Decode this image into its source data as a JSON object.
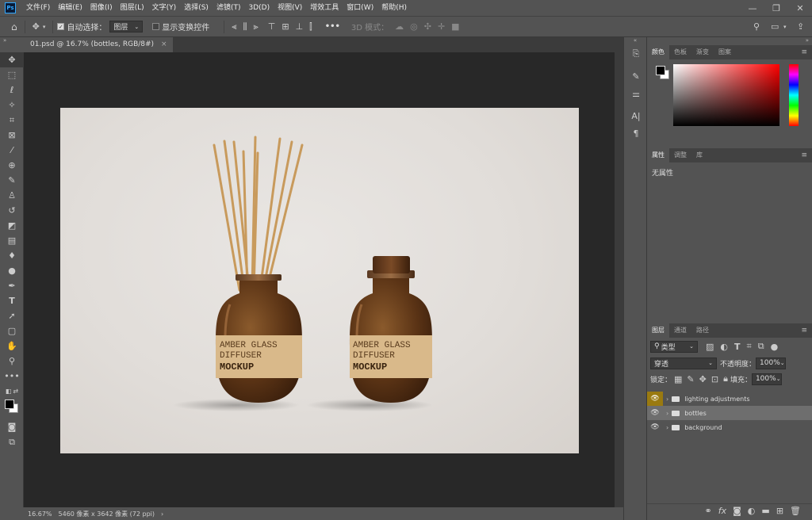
{
  "menubar": {
    "logo": "Ps",
    "items": [
      "文件(F)",
      "编辑(E)",
      "图像(I)",
      "图层(L)",
      "文字(Y)",
      "选择(S)",
      "滤镜(T)",
      "3D(D)",
      "视图(V)",
      "增效工具",
      "窗口(W)",
      "帮助(H)"
    ]
  },
  "window": {
    "minimize": "—",
    "restore": "❐",
    "close": "✕"
  },
  "options": {
    "auto_select_label": "自动选择：",
    "auto_select_target": "图层",
    "show_transform_label": "显示变换控件",
    "more": "•••",
    "mode_3d_label": "3D 模式："
  },
  "document_tab": {
    "title": "01.psd @ 16.7% (bottles, RGB/8#)",
    "close": "×"
  },
  "status": {
    "zoom": "16.67%",
    "dimensions": "5460 像素 x 3642 像素 (72 ppi)",
    "arrow": "›"
  },
  "mockup": {
    "left_label": [
      "AMBER GLASS",
      "DIFFUSER",
      "MOCKUP"
    ],
    "right_label": [
      "AMBER GLASS",
      "DIFFUSER",
      "MOCKUP"
    ]
  },
  "color_panel": {
    "tabs": [
      "颜色",
      "色板",
      "渐变",
      "图案"
    ],
    "fg": "#000000",
    "bg": "#ffffff",
    "hue_color": "#ff0000"
  },
  "properties_panel": {
    "tabs": [
      "属性",
      "调整",
      "库"
    ],
    "empty_text": "无属性"
  },
  "layers_panel": {
    "tabs": [
      "图层",
      "通道",
      "路径"
    ],
    "filter_label": "类型",
    "blend_mode": "穿透",
    "opacity_label": "不透明度：",
    "opacity_value": "100%",
    "lock_label": "锁定：",
    "fill_label": "填充：",
    "fill_value": "100%",
    "layers": [
      {
        "name": "lighting adjustments",
        "selected": false,
        "eye_highlight": true
      },
      {
        "name": "bottles",
        "selected": true,
        "eye_highlight": false
      },
      {
        "name": "background",
        "selected": false,
        "eye_highlight": false
      }
    ]
  }
}
